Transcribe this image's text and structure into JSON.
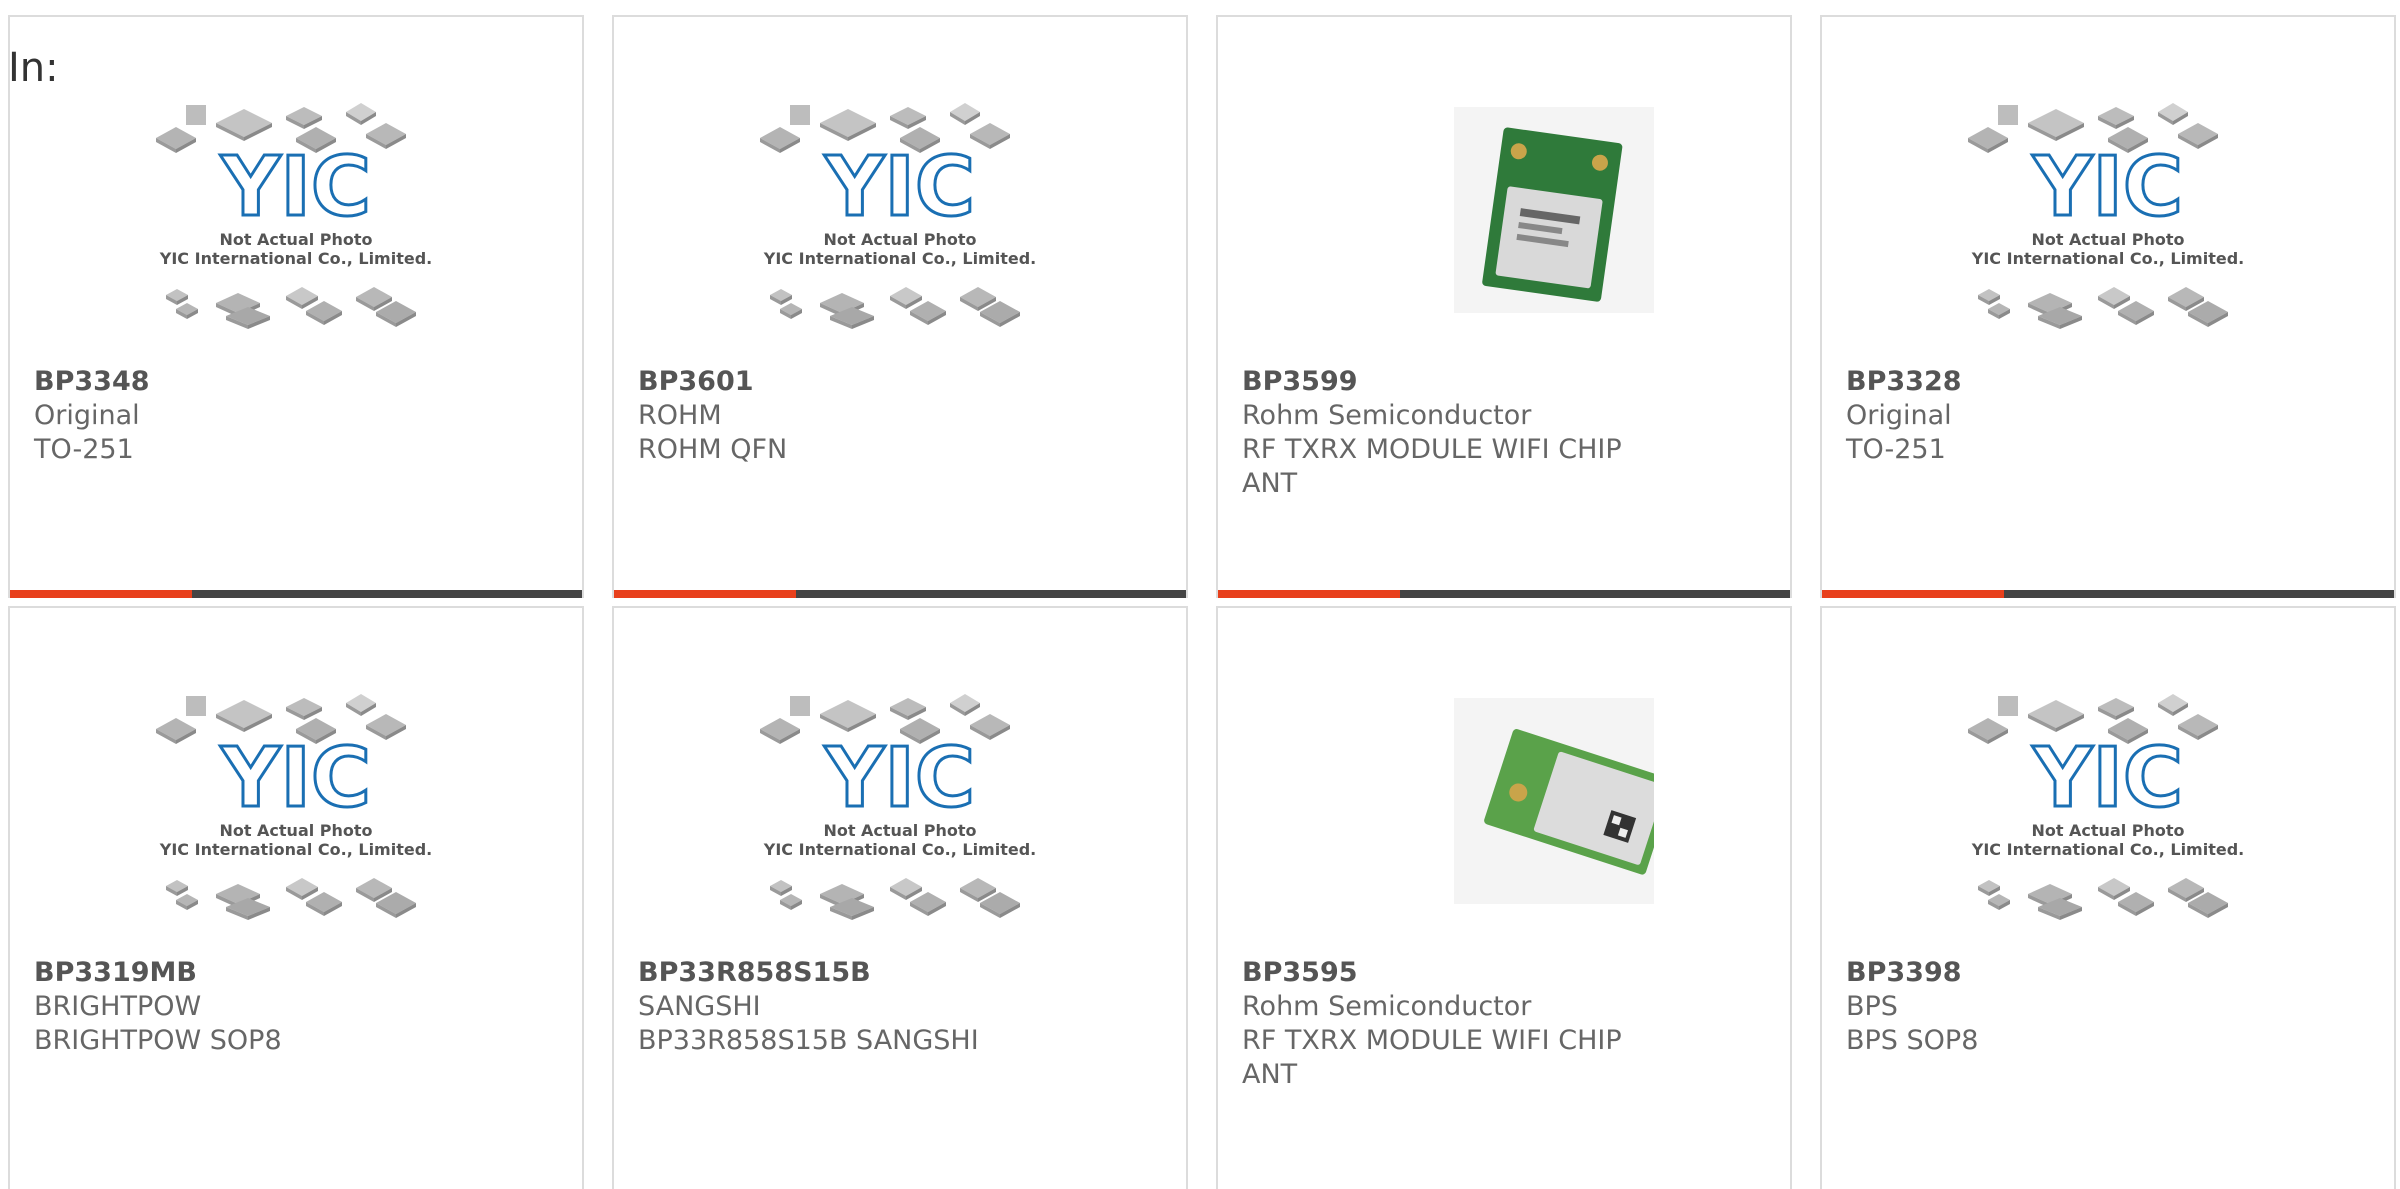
{
  "header": {
    "in_label": "In:"
  },
  "colors": {
    "accent": "#e8401c",
    "bar": "#444444",
    "border": "#dcdcdc",
    "yic_blue": "#1a6fb3"
  },
  "placeholder": {
    "line1": "Not Actual Photo",
    "line2": "YIC International Co., Limited.",
    "logo": "YIC"
  },
  "products": [
    {
      "part": "BP3348",
      "manufacturer": "Original",
      "description": "TO-251",
      "image": "yic-placeholder"
    },
    {
      "part": "BP3601",
      "manufacturer": "ROHM",
      "description": "ROHM QFN",
      "image": "yic-placeholder"
    },
    {
      "part": "BP3599",
      "manufacturer": "Rohm Semiconductor",
      "description": "RF TXRX MODULE WIFI CHIP ANT",
      "image": "wifi-module-photo"
    },
    {
      "part": "BP3328",
      "manufacturer": "Original",
      "description": "TO-251",
      "image": "yic-placeholder"
    },
    {
      "part": "BP3319MB",
      "manufacturer": "BRIGHTPOW",
      "description": "BRIGHTPOW SOP8",
      "image": "yic-placeholder"
    },
    {
      "part": "BP33R858S15B",
      "manufacturer": "SANGSHI",
      "description": "BP33R858S15B SANGSHI",
      "image": "yic-placeholder"
    },
    {
      "part": "BP3595",
      "manufacturer": "Rohm Semiconductor",
      "description": "RF TXRX MODULE WIFI CHIP ANT",
      "image": "wifi-module-photo-2"
    },
    {
      "part": "BP3398",
      "manufacturer": "BPS",
      "description": "BPS SOP8",
      "image": "yic-placeholder"
    }
  ]
}
